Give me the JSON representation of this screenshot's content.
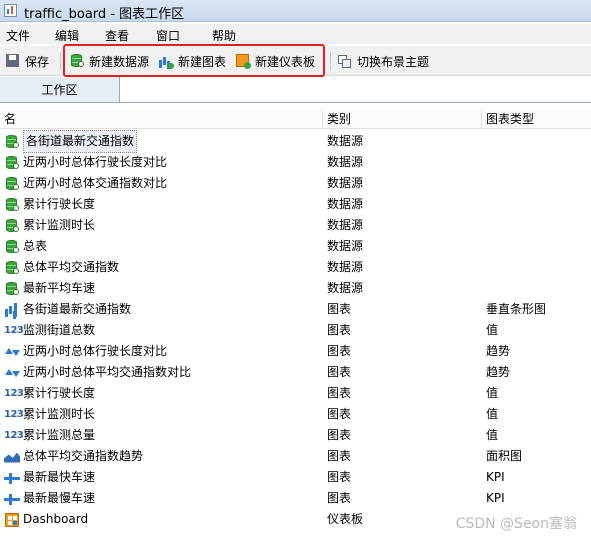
{
  "window": {
    "title": "traffic_board - 图表工作区"
  },
  "menu": [
    "文件",
    "编辑",
    "查看",
    "窗口",
    "帮助"
  ],
  "toolbar": {
    "save": "保存",
    "new_datasource": "新建数据源",
    "new_chart": "新建图表",
    "new_dashboard": "新建仪表板",
    "switch_theme": "切换布景主题",
    "highlight_color": "#e02020"
  },
  "tabs": {
    "workspace": "工作区"
  },
  "table": {
    "headers": [
      "名",
      "类别",
      "图表类型"
    ],
    "rows": [
      {
        "icon": "database-icon",
        "name": "各街道最新交通指数",
        "category": "数据源",
        "chart_type": ""
      },
      {
        "icon": "database-icon",
        "name": "近两小时总体行驶长度对比",
        "category": "数据源",
        "chart_type": ""
      },
      {
        "icon": "database-icon",
        "name": "近两小时总体交通指数对比",
        "category": "数据源",
        "chart_type": ""
      },
      {
        "icon": "database-icon",
        "name": "累计行驶长度",
        "category": "数据源",
        "chart_type": ""
      },
      {
        "icon": "database-icon",
        "name": "累计监测时长",
        "category": "数据源",
        "chart_type": ""
      },
      {
        "icon": "database-icon",
        "name": "总表",
        "category": "数据源",
        "chart_type": ""
      },
      {
        "icon": "database-icon",
        "name": "总体平均交通指数",
        "category": "数据源",
        "chart_type": ""
      },
      {
        "icon": "database-icon",
        "name": "最新平均车速",
        "category": "数据源",
        "chart_type": ""
      },
      {
        "icon": "bar-chart-icon",
        "name": "各街道最新交通指数",
        "category": "图表",
        "chart_type": "垂直条形图"
      },
      {
        "icon": "value-123-icon",
        "name": "监测街道总数",
        "category": "图表",
        "chart_type": "值"
      },
      {
        "icon": "trend-icon",
        "name": "近两小时总体行驶长度对比",
        "category": "图表",
        "chart_type": "趋势"
      },
      {
        "icon": "trend-icon",
        "name": "近两小时总体平均交通指数对比",
        "category": "图表",
        "chart_type": "趋势"
      },
      {
        "icon": "value-123-icon",
        "name": "累计行驶长度",
        "category": "图表",
        "chart_type": "值"
      },
      {
        "icon": "value-123-icon",
        "name": "累计监测时长",
        "category": "图表",
        "chart_type": "值"
      },
      {
        "icon": "value-123-icon",
        "name": "累计监测总量",
        "category": "图表",
        "chart_type": "值"
      },
      {
        "icon": "area-chart-icon",
        "name": "总体平均交通指数趋势",
        "category": "图表",
        "chart_type": "面积图"
      },
      {
        "icon": "kpi-icon",
        "name": "最新最快车速",
        "category": "图表",
        "chart_type": "KPI"
      },
      {
        "icon": "kpi-icon",
        "name": "最新最慢车速",
        "category": "图表",
        "chart_type": "KPI"
      },
      {
        "icon": "dashboard-icon",
        "name": "Dashboard",
        "category": "仪表板",
        "chart_type": ""
      }
    ]
  },
  "watermark": "CSDN @Seon塞翁",
  "num_icon_text": "123"
}
